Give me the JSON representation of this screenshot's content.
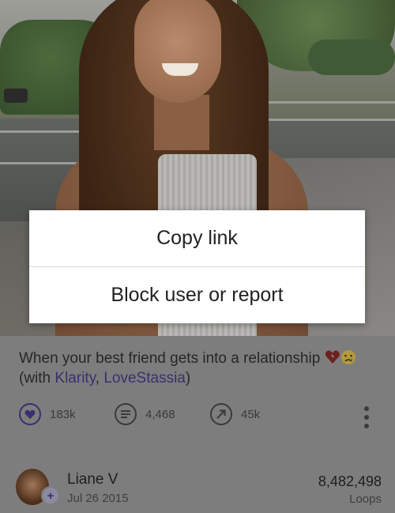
{
  "popup": {
    "items": [
      {
        "label": "Copy link"
      },
      {
        "label": "Block user or report"
      }
    ]
  },
  "post": {
    "caption_text": "When your best friend gets into a relationship",
    "with_prefix": "(with ",
    "mention_1": "Klarity",
    "separator": ", ",
    "mention_2": "LoveStassia",
    "with_suffix": ")",
    "emojis": [
      "broken-heart-emoji",
      "crying-face-emoji"
    ]
  },
  "actions": {
    "likes": "183k",
    "comments": "4,468",
    "revines": "45k"
  },
  "author": {
    "name": "Liane V",
    "date": "Jul 26 2015",
    "loops_count": "8,482,498",
    "loops_label": "Loops"
  },
  "colors": {
    "accent": "#3b2f6e",
    "dim_background": "#7d7d7d",
    "popup_background": "#ffffff"
  }
}
